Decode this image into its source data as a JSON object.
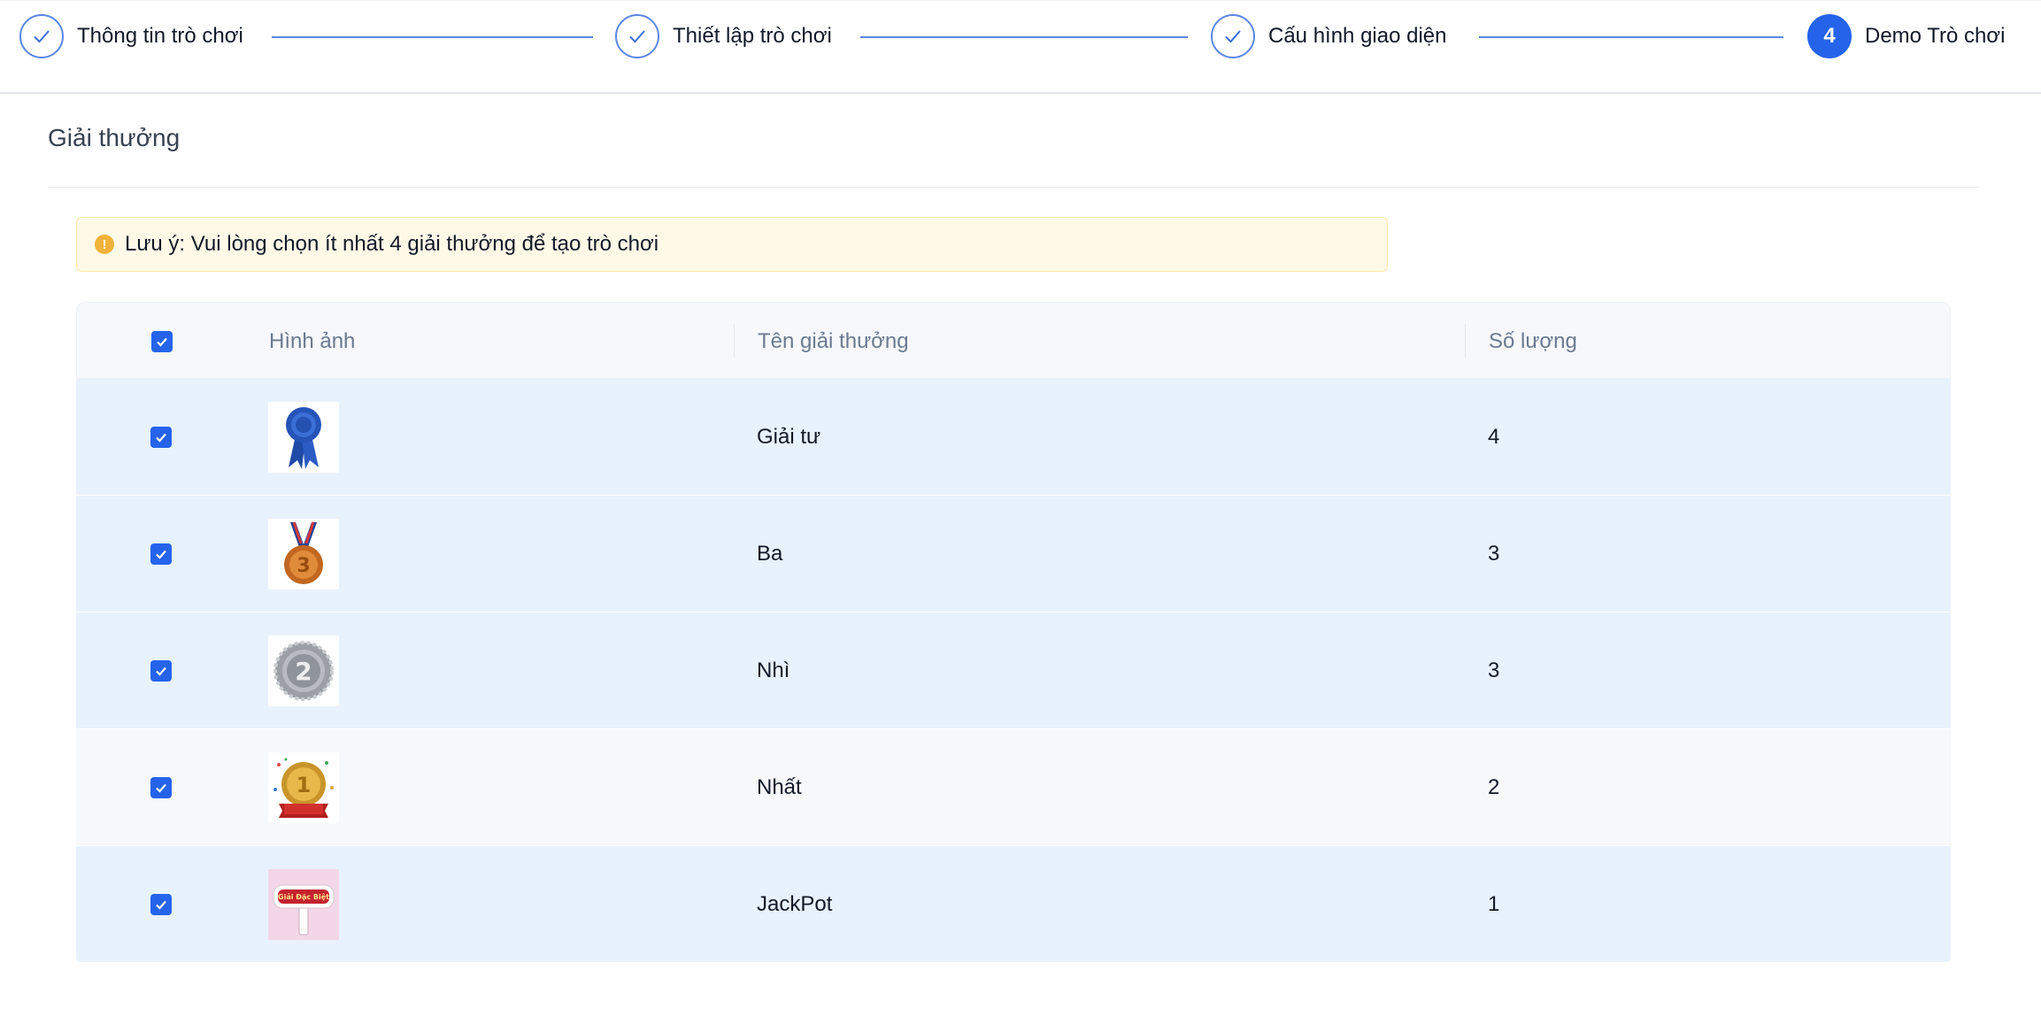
{
  "stepper": {
    "steps": [
      {
        "label": "Thông tin trò chơi",
        "state": "done"
      },
      {
        "label": "Thiết lập trò chơi",
        "state": "done"
      },
      {
        "label": "Cấu hình giao diện",
        "state": "done"
      },
      {
        "label": "Demo Trò chơi",
        "state": "active",
        "number": "4"
      }
    ],
    "accent": "#2563eb",
    "line_color": "#5b86e5"
  },
  "section": {
    "title": "Giải thưởng"
  },
  "alert": {
    "icon": "info-icon",
    "text": "Lưu ý: Vui lòng chọn ít nhất 4 giải thưởng để tạo trò chơi"
  },
  "table": {
    "columns": {
      "image": "Hình ảnh",
      "name": "Tên giải thưởng",
      "quantity": "Số lượng"
    },
    "select_all_checked": true,
    "rows": [
      {
        "name": "Giải tư",
        "quantity": "4",
        "image_icon": "blue-ribbon-icon",
        "checked": true
      },
      {
        "name": "Ba",
        "quantity": "3",
        "image_icon": "bronze-medal-3-icon",
        "checked": true
      },
      {
        "name": "Nhì",
        "quantity": "3",
        "image_icon": "silver-medal-2-icon",
        "checked": true
      },
      {
        "name": "Nhất",
        "quantity": "2",
        "image_icon": "gold-medal-1-icon",
        "checked": true
      },
      {
        "name": "JackPot",
        "quantity": "1",
        "image_icon": "special-prize-sign-icon",
        "checked": true,
        "image_text": "Giải Đặc Biệt"
      }
    ]
  }
}
